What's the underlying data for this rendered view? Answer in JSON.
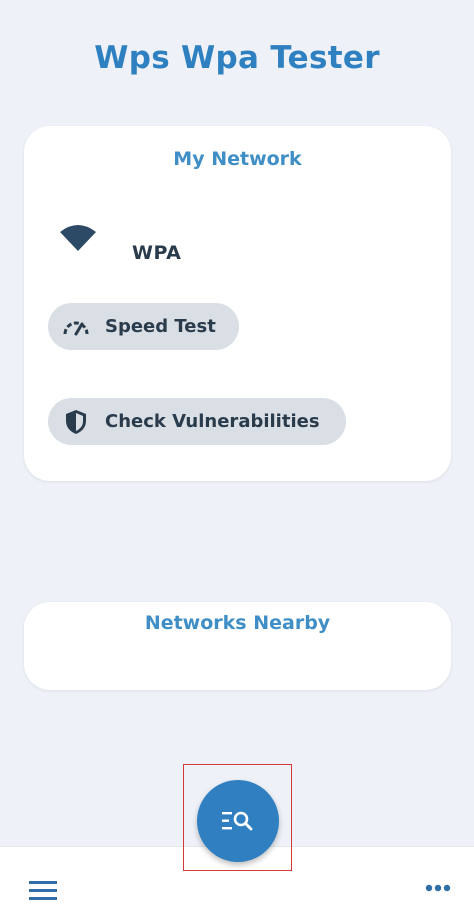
{
  "app": {
    "title": "Wps Wpa Tester"
  },
  "my_network": {
    "title": "My Network",
    "security_type": "WPA",
    "speed_test_label": "Speed Test",
    "check_vulnerabilities_label": "Check Vulnerabilities",
    "icons": {
      "network": "wifi-icon",
      "speed": "speedometer-icon",
      "vulnerabilities": "shield-icon"
    }
  },
  "networks_nearby": {
    "title": "Networks Nearby"
  },
  "fab": {
    "icon": "list-search-icon",
    "highlighted": true
  },
  "bottom_bar": {
    "left_icon": "menu-icon",
    "right_icon": "more-icon"
  },
  "colors": {
    "background": "#eef2f8",
    "accent": "#2f80c0",
    "card": "#ffffff",
    "chip": "#d9dfe5",
    "text_dark": "#2a3b4c",
    "highlight_box": "#d33a3a"
  }
}
